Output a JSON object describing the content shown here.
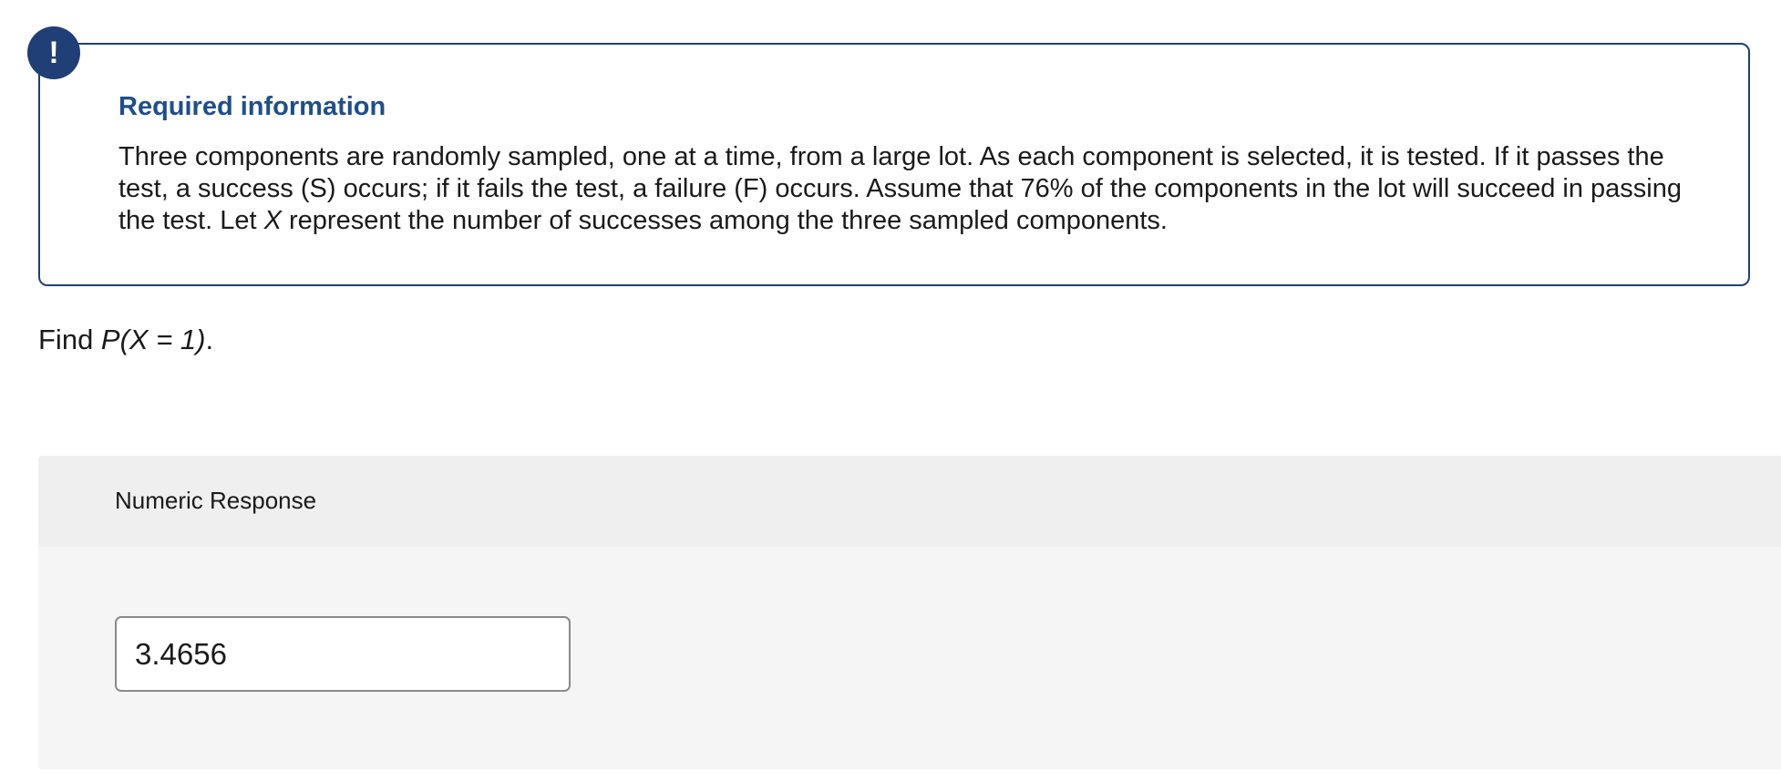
{
  "info": {
    "badge": "!",
    "title": "Required information",
    "body_part1": "Three components are randomly sampled, one at a time, from a large lot. As each component is selected, it is tested. If it passes the test, a success (S) occurs; if it fails the test, a failure (F) occurs. Assume that 76% of the components in the lot will succeed in passing the test. Let ",
    "body_var": "X",
    "body_part2": " represent the number of successes among the three sampled components."
  },
  "prompt": {
    "prefix": "Find ",
    "expression": "P(X = 1)",
    "suffix": "."
  },
  "response": {
    "header_label": "Numeric Response",
    "value": "3.4656"
  },
  "colors": {
    "accent": "#1f3f76",
    "title": "#1f4e8c",
    "panel_bg": "#f5f5f5",
    "panel_header_bg": "#efefef"
  }
}
